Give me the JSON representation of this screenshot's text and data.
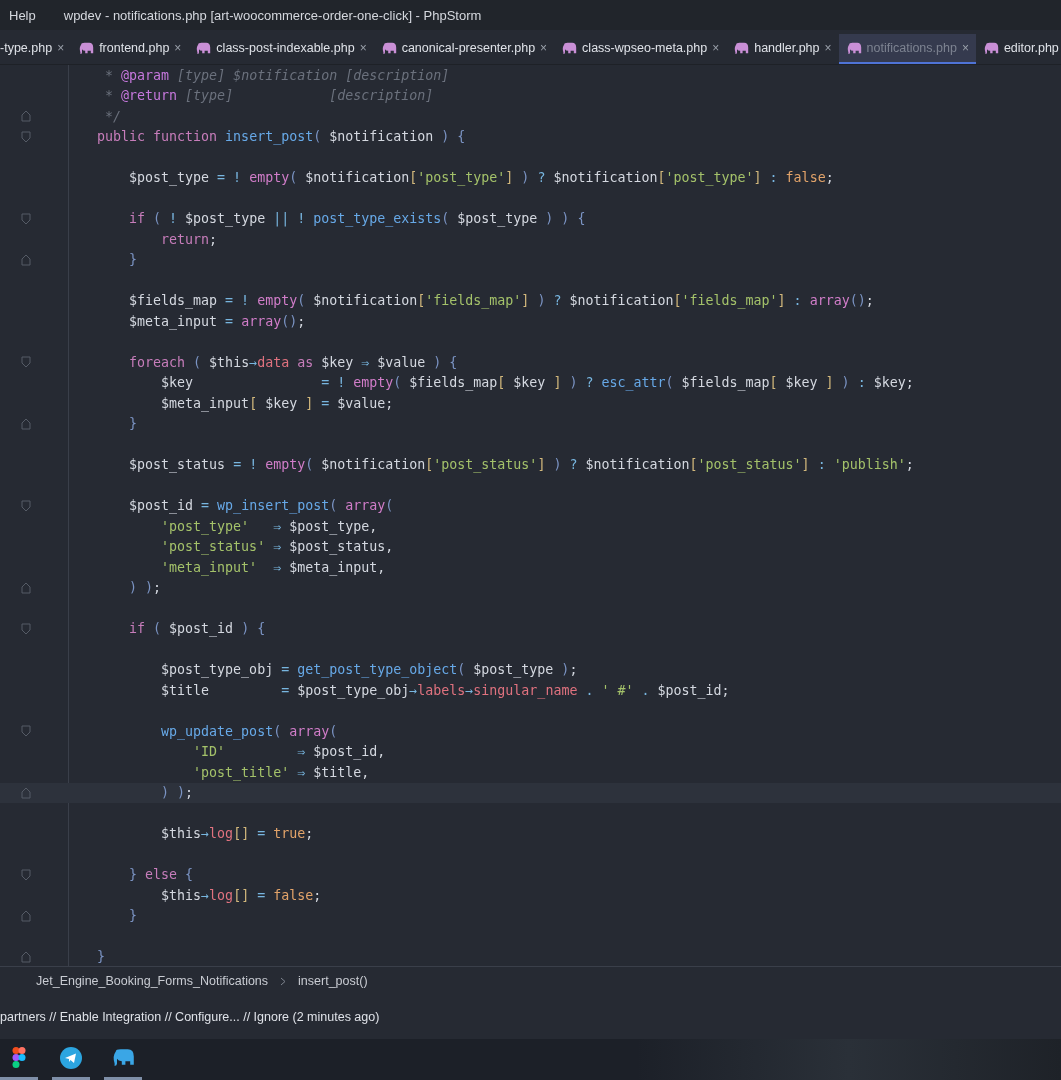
{
  "menu": [
    "Help"
  ],
  "window": {
    "title": "wpdev - notifications.php [art-woocommerce-order-one-click] - PhpStorm"
  },
  "tabs": [
    {
      "label": "-type.php",
      "icon": false,
      "close": "×",
      "selected": false
    },
    {
      "label": "frontend.php",
      "icon": true,
      "close": "×",
      "selected": false
    },
    {
      "label": "class-post-indexable.php",
      "icon": true,
      "close": "×",
      "selected": false
    },
    {
      "label": "canonical-presenter.php",
      "icon": true,
      "close": "×",
      "selected": false
    },
    {
      "label": "class-wpseo-meta.php",
      "icon": true,
      "close": "×",
      "selected": false
    },
    {
      "label": "handler.php",
      "icon": true,
      "close": "×",
      "selected": false
    },
    {
      "label": "notifications.php",
      "icon": true,
      "close": "×",
      "selected": true
    },
    {
      "label": "editor.php",
      "icon": true,
      "selected": false
    }
  ],
  "code_lines": [
    {
      "kind": "plain",
      "current": false,
      "tokens": [
        {
          "kind": "comment",
          "text": "     * "
        },
        {
          "kind": "tag",
          "text": "@param"
        },
        {
          "kind": "comment",
          "text": " [type] $notification [description]"
        }
      ]
    },
    {
      "kind": "plain",
      "current": false,
      "tokens": [
        {
          "kind": "comment",
          "text": "     * "
        },
        {
          "kind": "tag",
          "text": "@return"
        },
        {
          "kind": "comment",
          "text": " [type]            [description]"
        }
      ]
    },
    {
      "kind": "fold_close",
      "current": false,
      "tokens": [
        {
          "kind": "comment",
          "text": "     */"
        }
      ]
    },
    {
      "kind": "fold_open",
      "current": false,
      "tokens": [
        {
          "kind": "kw",
          "text": "    public function "
        },
        {
          "kind": "fn",
          "text": "insert_post"
        },
        {
          "kind": "punct",
          "text": "( "
        },
        {
          "kind": "var",
          "text": "$notification "
        },
        {
          "kind": "punct",
          "text": ") {"
        }
      ]
    },
    {
      "kind": "plain",
      "current": false
    },
    {
      "kind": "plain",
      "current": false,
      "tokens": [
        {
          "kind": "var",
          "text": "        $post_type "
        },
        {
          "kind": "op",
          "text": "= ! "
        },
        {
          "kind": "builtin",
          "text": "empty"
        },
        {
          "kind": "punct",
          "text": "( "
        },
        {
          "kind": "var",
          "text": "$notification"
        },
        {
          "kind": "bracket",
          "text": "["
        },
        {
          "kind": "str",
          "text": "'post_type'"
        },
        {
          "kind": "bracket",
          "text": "]"
        },
        {
          "kind": "punct",
          "text": " ) "
        },
        {
          "kind": "op",
          "text": "? "
        },
        {
          "kind": "var",
          "text": "$notification"
        },
        {
          "kind": "bracket",
          "text": "["
        },
        {
          "kind": "str",
          "text": "'post_type'"
        },
        {
          "kind": "bracket",
          "text": "]"
        },
        {
          "kind": "op",
          "text": " : "
        },
        {
          "kind": "const",
          "text": "false"
        },
        {
          "kind": "var",
          "text": ";"
        }
      ]
    },
    {
      "kind": "plain",
      "current": false
    },
    {
      "kind": "fold_open",
      "current": false,
      "tokens": [
        {
          "kind": "kw",
          "text": "        if "
        },
        {
          "kind": "punct",
          "text": "( "
        },
        {
          "kind": "op",
          "text": "! "
        },
        {
          "kind": "var",
          "text": "$post_type "
        },
        {
          "kind": "op",
          "text": "|| ! "
        },
        {
          "kind": "fn",
          "text": "post_type_exists"
        },
        {
          "kind": "punct",
          "text": "( "
        },
        {
          "kind": "var",
          "text": "$post_type "
        },
        {
          "kind": "punct",
          "text": ") ) {"
        }
      ]
    },
    {
      "kind": "plain",
      "current": false,
      "tokens": [
        {
          "kind": "kw",
          "text": "            return"
        },
        {
          "kind": "var",
          "text": ";"
        }
      ]
    },
    {
      "kind": "fold_close",
      "current": false,
      "tokens": [
        {
          "kind": "punct",
          "text": "        }"
        }
      ]
    },
    {
      "kind": "plain",
      "current": false
    },
    {
      "kind": "plain",
      "current": false,
      "tokens": [
        {
          "kind": "var",
          "text": "        $fields_map "
        },
        {
          "kind": "op",
          "text": "= ! "
        },
        {
          "kind": "builtin",
          "text": "empty"
        },
        {
          "kind": "punct",
          "text": "( "
        },
        {
          "kind": "var",
          "text": "$notification"
        },
        {
          "kind": "bracket",
          "text": "["
        },
        {
          "kind": "str",
          "text": "'fields_map'"
        },
        {
          "kind": "bracket",
          "text": "]"
        },
        {
          "kind": "punct",
          "text": " ) "
        },
        {
          "kind": "op",
          "text": "? "
        },
        {
          "kind": "var",
          "text": "$notification"
        },
        {
          "kind": "bracket",
          "text": "["
        },
        {
          "kind": "str",
          "text": "'fields_map'"
        },
        {
          "kind": "bracket",
          "text": "]"
        },
        {
          "kind": "op",
          "text": " : "
        },
        {
          "kind": "builtin",
          "text": "array"
        },
        {
          "kind": "punct",
          "text": "()"
        },
        {
          "kind": "var",
          "text": ";"
        }
      ]
    },
    {
      "kind": "plain",
      "current": false,
      "tokens": [
        {
          "kind": "var",
          "text": "        $meta_input "
        },
        {
          "kind": "op",
          "text": "= "
        },
        {
          "kind": "builtin",
          "text": "array"
        },
        {
          "kind": "punct",
          "text": "()"
        },
        {
          "kind": "var",
          "text": ";"
        }
      ]
    },
    {
      "kind": "plain",
      "current": false
    },
    {
      "kind": "fold_open",
      "current": false,
      "tokens": [
        {
          "kind": "kw",
          "text": "        foreach "
        },
        {
          "kind": "punct",
          "text": "( "
        },
        {
          "kind": "var",
          "text": "$this"
        },
        {
          "kind": "op",
          "text": "→"
        },
        {
          "kind": "prop",
          "text": "data "
        },
        {
          "kind": "kw",
          "text": "as "
        },
        {
          "kind": "var",
          "text": "$key "
        },
        {
          "kind": "op",
          "text": "⇒ "
        },
        {
          "kind": "var",
          "text": "$value "
        },
        {
          "kind": "punct",
          "text": ") {"
        }
      ]
    },
    {
      "kind": "plain",
      "current": false,
      "tokens": [
        {
          "kind": "var",
          "text": "            $key                "
        },
        {
          "kind": "op",
          "text": "= ! "
        },
        {
          "kind": "builtin",
          "text": "empty"
        },
        {
          "kind": "punct",
          "text": "( "
        },
        {
          "kind": "var",
          "text": "$fields_map"
        },
        {
          "kind": "bracket",
          "text": "[ "
        },
        {
          "kind": "var",
          "text": "$key "
        },
        {
          "kind": "bracket",
          "text": "] "
        },
        {
          "kind": "punct",
          "text": ") "
        },
        {
          "kind": "op",
          "text": "? "
        },
        {
          "kind": "fn",
          "text": "esc_attr"
        },
        {
          "kind": "punct",
          "text": "( "
        },
        {
          "kind": "var",
          "text": "$fields_map"
        },
        {
          "kind": "bracket",
          "text": "[ "
        },
        {
          "kind": "var",
          "text": "$key "
        },
        {
          "kind": "bracket",
          "text": "] "
        },
        {
          "kind": "punct",
          "text": ") "
        },
        {
          "kind": "op",
          "text": ": "
        },
        {
          "kind": "var",
          "text": "$key;"
        }
      ]
    },
    {
      "kind": "plain",
      "current": false,
      "tokens": [
        {
          "kind": "var",
          "text": "            $meta_input"
        },
        {
          "kind": "bracket",
          "text": "[ "
        },
        {
          "kind": "var",
          "text": "$key "
        },
        {
          "kind": "bracket",
          "text": "] "
        },
        {
          "kind": "op",
          "text": "= "
        },
        {
          "kind": "var",
          "text": "$value;"
        }
      ]
    },
    {
      "kind": "fold_close",
      "current": false,
      "tokens": [
        {
          "kind": "punct",
          "text": "        }"
        }
      ]
    },
    {
      "kind": "plain",
      "current": false
    },
    {
      "kind": "plain",
      "current": false,
      "tokens": [
        {
          "kind": "var",
          "text": "        $post_status "
        },
        {
          "kind": "op",
          "text": "= ! "
        },
        {
          "kind": "builtin",
          "text": "empty"
        },
        {
          "kind": "punct",
          "text": "( "
        },
        {
          "kind": "var",
          "text": "$notification"
        },
        {
          "kind": "bracket",
          "text": "["
        },
        {
          "kind": "str",
          "text": "'post_status'"
        },
        {
          "kind": "bracket",
          "text": "]"
        },
        {
          "kind": "punct",
          "text": " ) "
        },
        {
          "kind": "op",
          "text": "? "
        },
        {
          "kind": "var",
          "text": "$notification"
        },
        {
          "kind": "bracket",
          "text": "["
        },
        {
          "kind": "str",
          "text": "'post_status'"
        },
        {
          "kind": "bracket",
          "text": "]"
        },
        {
          "kind": "op",
          "text": " : "
        },
        {
          "kind": "str",
          "text": "'publish'"
        },
        {
          "kind": "var",
          "text": ";"
        }
      ]
    },
    {
      "kind": "plain",
      "current": false
    },
    {
      "kind": "fold_open",
      "current": false,
      "tokens": [
        {
          "kind": "var",
          "text": "        $post_id "
        },
        {
          "kind": "op",
          "text": "= "
        },
        {
          "kind": "fn",
          "text": "wp_insert_post"
        },
        {
          "kind": "punct",
          "text": "( "
        },
        {
          "kind": "builtin",
          "text": "array"
        },
        {
          "kind": "punct",
          "text": "("
        }
      ]
    },
    {
      "kind": "plain",
      "current": false,
      "tokens": [
        {
          "kind": "str",
          "text": "            'post_type'   "
        },
        {
          "kind": "op",
          "text": "⇒ "
        },
        {
          "kind": "var",
          "text": "$post_type,"
        }
      ]
    },
    {
      "kind": "plain",
      "current": false,
      "tokens": [
        {
          "kind": "str",
          "text": "            'post_status' "
        },
        {
          "kind": "op",
          "text": "⇒ "
        },
        {
          "kind": "var",
          "text": "$post_status,"
        }
      ]
    },
    {
      "kind": "plain",
      "current": false,
      "tokens": [
        {
          "kind": "str",
          "text": "            'meta_input'  "
        },
        {
          "kind": "op",
          "text": "⇒ "
        },
        {
          "kind": "var",
          "text": "$meta_input,"
        }
      ]
    },
    {
      "kind": "fold_close",
      "current": false,
      "tokens": [
        {
          "kind": "punct",
          "text": "        ) )"
        },
        {
          "kind": "var",
          "text": ";"
        }
      ]
    },
    {
      "kind": "plain",
      "current": false
    },
    {
      "kind": "fold_open",
      "current": false,
      "tokens": [
        {
          "kind": "kw",
          "text": "        if "
        },
        {
          "kind": "punct",
          "text": "( "
        },
        {
          "kind": "var",
          "text": "$post_id "
        },
        {
          "kind": "punct",
          "text": ") {"
        }
      ]
    },
    {
      "kind": "plain",
      "current": false
    },
    {
      "kind": "plain",
      "current": false,
      "tokens": [
        {
          "kind": "var",
          "text": "            $post_type_obj "
        },
        {
          "kind": "op",
          "text": "= "
        },
        {
          "kind": "fn",
          "text": "get_post_type_object"
        },
        {
          "kind": "punct",
          "text": "( "
        },
        {
          "kind": "var",
          "text": "$post_type "
        },
        {
          "kind": "punct",
          "text": ")"
        },
        {
          "kind": "var",
          "text": ";"
        }
      ]
    },
    {
      "kind": "plain",
      "current": false,
      "tokens": [
        {
          "kind": "var",
          "text": "            $title         "
        },
        {
          "kind": "op",
          "text": "= "
        },
        {
          "kind": "var",
          "text": "$post_type_obj"
        },
        {
          "kind": "op",
          "text": "→"
        },
        {
          "kind": "prop",
          "text": "labels"
        },
        {
          "kind": "op",
          "text": "→"
        },
        {
          "kind": "prop",
          "text": "singular_name "
        },
        {
          "kind": "op",
          "text": ". "
        },
        {
          "kind": "str",
          "text": "' #' "
        },
        {
          "kind": "op",
          "text": ". "
        },
        {
          "kind": "var",
          "text": "$post_id;"
        }
      ]
    },
    {
      "kind": "plain",
      "current": false
    },
    {
      "kind": "fold_open",
      "current": false,
      "tokens": [
        {
          "kind": "fn",
          "text": "            wp_update_post"
        },
        {
          "kind": "punct",
          "text": "( "
        },
        {
          "kind": "builtin",
          "text": "array"
        },
        {
          "kind": "punct",
          "text": "("
        }
      ]
    },
    {
      "kind": "plain",
      "current": false,
      "tokens": [
        {
          "kind": "str",
          "text": "                'ID'         "
        },
        {
          "kind": "op",
          "text": "⇒ "
        },
        {
          "kind": "var",
          "text": "$post_id,"
        }
      ]
    },
    {
      "kind": "plain",
      "current": false,
      "tokens": [
        {
          "kind": "str",
          "text": "                'post_title' "
        },
        {
          "kind": "op",
          "text": "⇒ "
        },
        {
          "kind": "var",
          "text": "$title,"
        }
      ]
    },
    {
      "kind": "fold_close",
      "current": true,
      "tokens": [
        {
          "kind": "punct",
          "text": "            ) )"
        },
        {
          "kind": "var",
          "text": ";"
        }
      ]
    },
    {
      "kind": "plain",
      "current": false
    },
    {
      "kind": "plain",
      "current": false,
      "tokens": [
        {
          "kind": "var",
          "text": "            $this"
        },
        {
          "kind": "op",
          "text": "→"
        },
        {
          "kind": "prop",
          "text": "log"
        },
        {
          "kind": "bracket",
          "text": "[]"
        },
        {
          "kind": "op",
          "text": " = "
        },
        {
          "kind": "const",
          "text": "true"
        },
        {
          "kind": "var",
          "text": ";"
        }
      ]
    },
    {
      "kind": "plain",
      "current": false
    },
    {
      "kind": "fold_open",
      "current": false,
      "tokens": [
        {
          "kind": "punct",
          "text": "        } "
        },
        {
          "kind": "kw",
          "text": "else "
        },
        {
          "kind": "punct",
          "text": "{"
        }
      ]
    },
    {
      "kind": "plain",
      "current": false,
      "tokens": [
        {
          "kind": "var",
          "text": "            $this"
        },
        {
          "kind": "op",
          "text": "→"
        },
        {
          "kind": "prop",
          "text": "log"
        },
        {
          "kind": "bracket",
          "text": "[]"
        },
        {
          "kind": "op",
          "text": " = "
        },
        {
          "kind": "const",
          "text": "false"
        },
        {
          "kind": "var",
          "text": ";"
        }
      ]
    },
    {
      "kind": "fold_close",
      "current": false,
      "tokens": [
        {
          "kind": "punct",
          "text": "        }"
        }
      ]
    },
    {
      "kind": "plain",
      "current": false
    },
    {
      "kind": "fold_close",
      "current": false,
      "tokens": [
        {
          "kind": "punct",
          "text": "    }"
        }
      ]
    }
  ],
  "breadcrumb": [
    "Jet_Engine_Booking_Forms_Notifications",
    "insert_post()"
  ],
  "status_bar": {
    "message": "partners // Enable Integration // Configure... // Ignore (2 minutes ago)"
  },
  "taskbar": [
    {
      "kind": "shapes",
      "active": true
    },
    {
      "kind": "plane",
      "active": true
    },
    {
      "kind": "elephant",
      "active": true
    }
  ]
}
